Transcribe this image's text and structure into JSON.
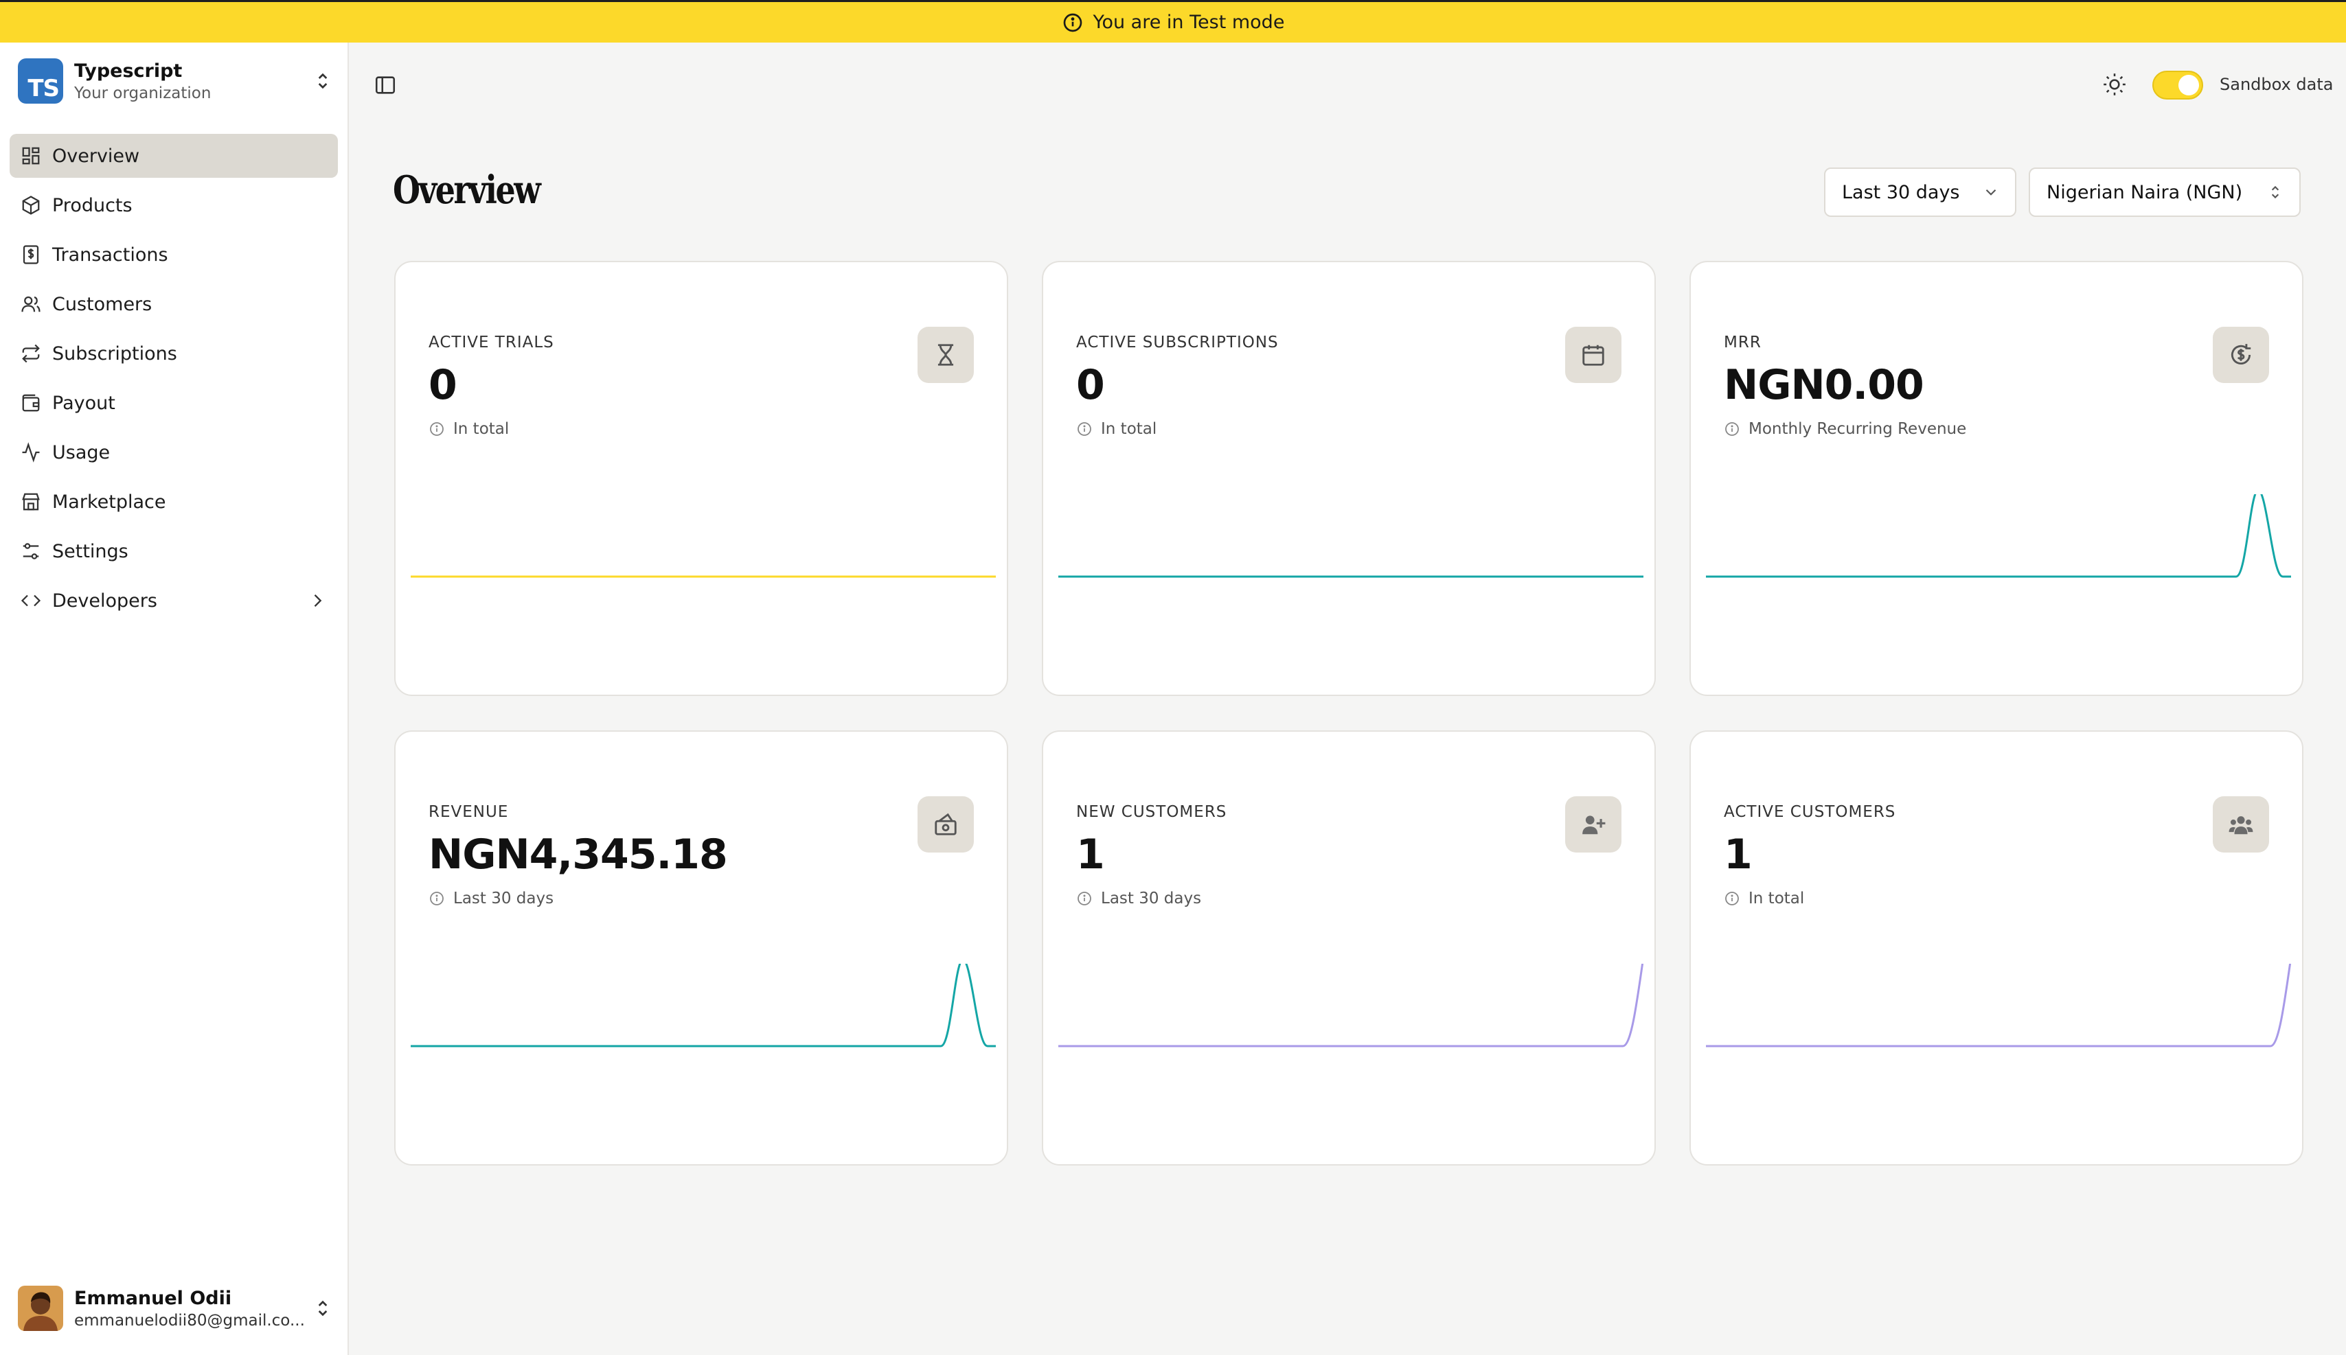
{
  "banner": {
    "text": "You are in Test mode"
  },
  "org": {
    "name": "Typescript",
    "subtitle": "Your organization",
    "logo_text": "TS"
  },
  "nav": {
    "items": [
      {
        "label": "Overview",
        "icon": "grid-icon"
      },
      {
        "label": "Products",
        "icon": "box-icon"
      },
      {
        "label": "Transactions",
        "icon": "receipt-icon"
      },
      {
        "label": "Customers",
        "icon": "users-icon"
      },
      {
        "label": "Subscriptions",
        "icon": "repeat-icon"
      },
      {
        "label": "Payout",
        "icon": "wallet-icon"
      },
      {
        "label": "Usage",
        "icon": "activity-icon"
      },
      {
        "label": "Marketplace",
        "icon": "store-icon"
      },
      {
        "label": "Settings",
        "icon": "sliders-icon"
      },
      {
        "label": "Developers",
        "icon": "code-icon"
      }
    ]
  },
  "user": {
    "name": "Emmanuel Odii",
    "email": "emmanuelodii80@gmail.co..."
  },
  "topbar": {
    "sandbox_label": "Sandbox data",
    "sandbox_on": true
  },
  "page": {
    "title": "Overview"
  },
  "filters": {
    "range": "Last 30 days",
    "currency": "Nigerian Naira (NGN)"
  },
  "colors": {
    "accent": "#fcd92a",
    "teal": "#14a6a6",
    "purple": "#a89ae8"
  },
  "cards": [
    {
      "label": "ACTIVE TRIALS",
      "value": "0",
      "note": "In total",
      "icon": "hourglass-icon",
      "line_color": "#fcd92a",
      "peak": "none"
    },
    {
      "label": "ACTIVE SUBSCRIPTIONS",
      "value": "0",
      "note": "In total",
      "icon": "calendar-icon",
      "line_color": "#14a6a6",
      "peak": "none"
    },
    {
      "label": "MRR",
      "value": "NGN0.00",
      "note": "Monthly Recurring Revenue",
      "icon": "dollar-refresh-icon",
      "line_color": "#14a6a6",
      "peak": "spike"
    },
    {
      "label": "REVENUE",
      "value": "NGN4,345.18",
      "note": "Last 30 days",
      "icon": "cash-icon",
      "line_color": "#14a6a6",
      "peak": "spike"
    },
    {
      "label": "NEW CUSTOMERS",
      "value": "1",
      "note": "Last 30 days",
      "icon": "user-plus-icon",
      "line_color": "#a89ae8",
      "peak": "rise"
    },
    {
      "label": "ACTIVE CUSTOMERS",
      "value": "1",
      "note": "In total",
      "icon": "users-group-icon",
      "line_color": "#a89ae8",
      "peak": "rise"
    }
  ]
}
